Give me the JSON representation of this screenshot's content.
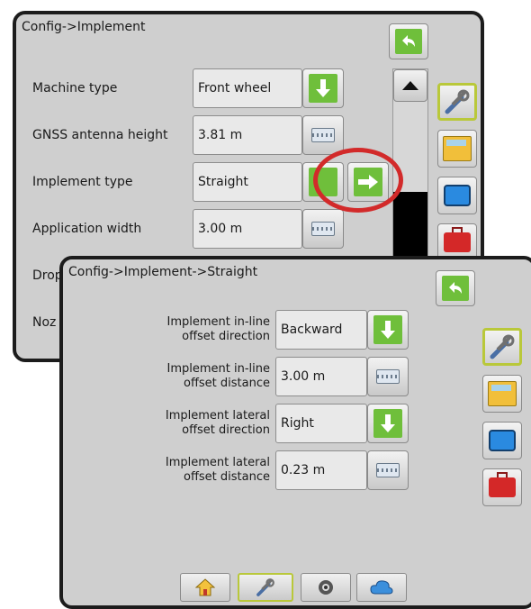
{
  "back_panel": {
    "title": "Config->Implement",
    "rows": [
      {
        "label": "Machine type",
        "value": "Front wheel",
        "control": "arrow-down"
      },
      {
        "label": "GNSS antenna height",
        "value": "3.81 m",
        "control": "keyboard"
      },
      {
        "label": "Implement type",
        "value": "Straight",
        "control": "arrow-down"
      },
      {
        "label": "Application width",
        "value": "3.00 m",
        "control": "keyboard"
      },
      {
        "label": "Drop",
        "value": "",
        "control": ""
      },
      {
        "label": "Noz",
        "value": "",
        "control": ""
      }
    ]
  },
  "front_panel": {
    "title": "Config->Implement->Straight",
    "rows": [
      {
        "label_line1": "Implement in-line",
        "label_line2": "offset direction",
        "value": "Backward",
        "control": "arrow-down"
      },
      {
        "label_line1": "Implement in-line",
        "label_line2": "offset distance",
        "value": "3.00 m",
        "control": "keyboard"
      },
      {
        "label_line1": "Implement lateral",
        "label_line2": "offset direction",
        "value": "Right",
        "control": "arrow-down"
      },
      {
        "label_line1": "Implement lateral",
        "label_line2": "offset distance",
        "value": "0.23 m",
        "control": "keyboard"
      }
    ]
  },
  "side_tabs": [
    "tools-icon",
    "console-icon",
    "display-icon",
    "toolbox-icon"
  ],
  "bottom_toolbar": [
    "home-icon",
    "tools-icon",
    "camera-icon",
    "cloud-icon"
  ],
  "colors": {
    "green": "#6fbf3b",
    "highlight_ring": "#d22a2a",
    "active_border": "#b9c83a",
    "panel_border": "#1c1c1c"
  }
}
